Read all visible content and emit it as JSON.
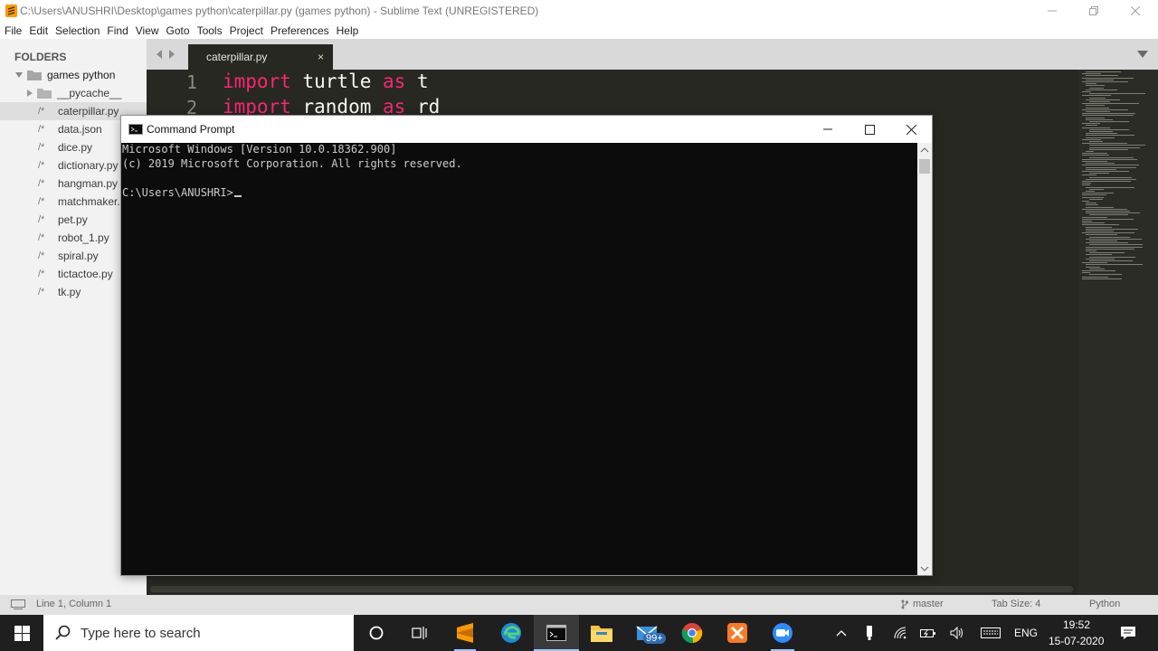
{
  "window": {
    "title": "C:\\Users\\ANUSHRI\\Desktop\\games python\\caterpillar.py (games python) - Sublime Text (UNREGISTERED)"
  },
  "menu": [
    "File",
    "Edit",
    "Selection",
    "Find",
    "View",
    "Goto",
    "Tools",
    "Project",
    "Preferences",
    "Help"
  ],
  "sidebar": {
    "heading": "FOLDERS",
    "root": "games python",
    "items": [
      {
        "label": "__pycache__",
        "type": "folder"
      },
      {
        "label": "caterpillar.py",
        "type": "file",
        "selected": true
      },
      {
        "label": "data.json",
        "type": "file"
      },
      {
        "label": "dice.py",
        "type": "file"
      },
      {
        "label": "dictionary.py",
        "type": "file"
      },
      {
        "label": "hangman.py",
        "type": "file"
      },
      {
        "label": "matchmaker.py",
        "type": "file"
      },
      {
        "label": "pet.py",
        "type": "file"
      },
      {
        "label": "robot_1.py",
        "type": "file"
      },
      {
        "label": "spiral.py",
        "type": "file"
      },
      {
        "label": "tictactoe.py",
        "type": "file"
      },
      {
        "label": "tk.py",
        "type": "file"
      }
    ],
    "file_prefix": "/*"
  },
  "tab": {
    "label": "caterpillar.py",
    "close": "×"
  },
  "editor": {
    "lines": [
      {
        "num": "1",
        "kw1": "import",
        "mid": " turtle ",
        "kw2": "as",
        "rest": " t"
      },
      {
        "num": "2",
        "kw1": "import",
        "mid": " random ",
        "kw2": "as",
        "rest": " rd"
      }
    ]
  },
  "statusbar": {
    "position": "Line 1, Column 1",
    "branch": "master",
    "tab_size": "Tab Size: 4",
    "syntax": "Python"
  },
  "cmd": {
    "title": "Command Prompt",
    "lines": [
      "Microsoft Windows [Version 10.0.18362.900]",
      "(c) 2019 Microsoft Corporation. All rights reserved.",
      "",
      "C:\\Users\\ANUSHRI>"
    ]
  },
  "taskbar": {
    "search_placeholder": "Type here to search",
    "mail_badge": "99+",
    "language": "ENG",
    "time": "19:52",
    "date": "15-07-2020"
  },
  "colors": {
    "editor_bg": "#272822",
    "keyword": "#f92672",
    "console_bg": "#0c0c0c",
    "taskbar_bg": "#1f1f1f",
    "sublime_orange": "#ff9800"
  }
}
